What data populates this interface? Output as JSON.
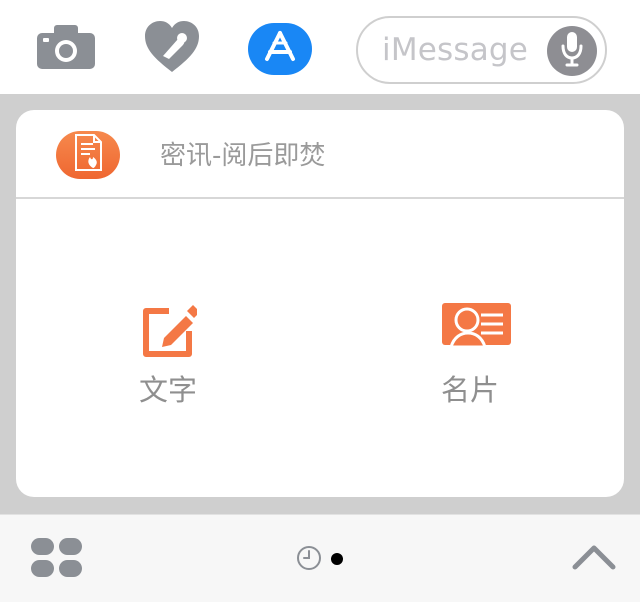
{
  "top_bar": {
    "camera_icon": "camera-icon",
    "digital_touch_icon": "heart-hand-icon",
    "app_store_icon": "app-store-icon",
    "message_input": {
      "placeholder": "iMessage"
    },
    "mic_icon": "microphone-icon"
  },
  "app_card": {
    "title": "密讯-阅后即焚",
    "app_icon": "fire-document-icon",
    "actions": [
      {
        "label": "文字",
        "icon": "edit-icon"
      },
      {
        "label": "名片",
        "icon": "contact-card-icon"
      }
    ]
  },
  "bottom_bar": {
    "grid_icon": "app-grid-icon",
    "recent_icon": "clock-icon",
    "expand_icon": "chevron-up-icon"
  },
  "colors": {
    "accent_orange": "#f47845",
    "app_store_blue": "#1987f5",
    "icon_gray": "#8b8f95",
    "label_gray": "#8f8f8f"
  }
}
